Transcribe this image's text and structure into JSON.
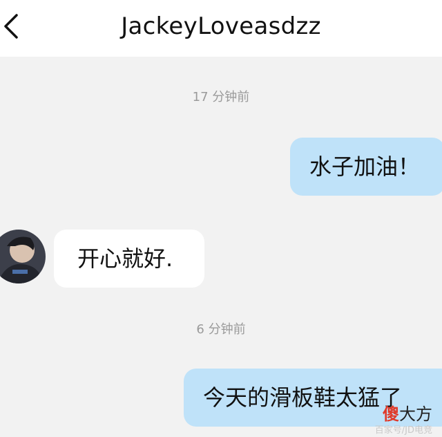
{
  "header": {
    "title": "JackeyLoveasdzz"
  },
  "icons": {
    "back": "chevron-left-icon"
  },
  "messages": [
    {
      "type": "timestamp",
      "text": "17 分钟前"
    },
    {
      "type": "outgoing",
      "text": "水子加油！"
    },
    {
      "type": "incoming",
      "text": "开心就好."
    },
    {
      "type": "timestamp",
      "text": "6 分钟前"
    },
    {
      "type": "outgoing",
      "text": "今天的滑板鞋太猛了"
    }
  ],
  "watermark": {
    "char1": "傻",
    "rest": "大方",
    "small": "百家号/JD电竞"
  },
  "colors": {
    "outgoing_bubble": "#bfe2f9",
    "incoming_bubble": "#ffffff",
    "background": "#f2f2f2",
    "header": "#ffffff"
  }
}
